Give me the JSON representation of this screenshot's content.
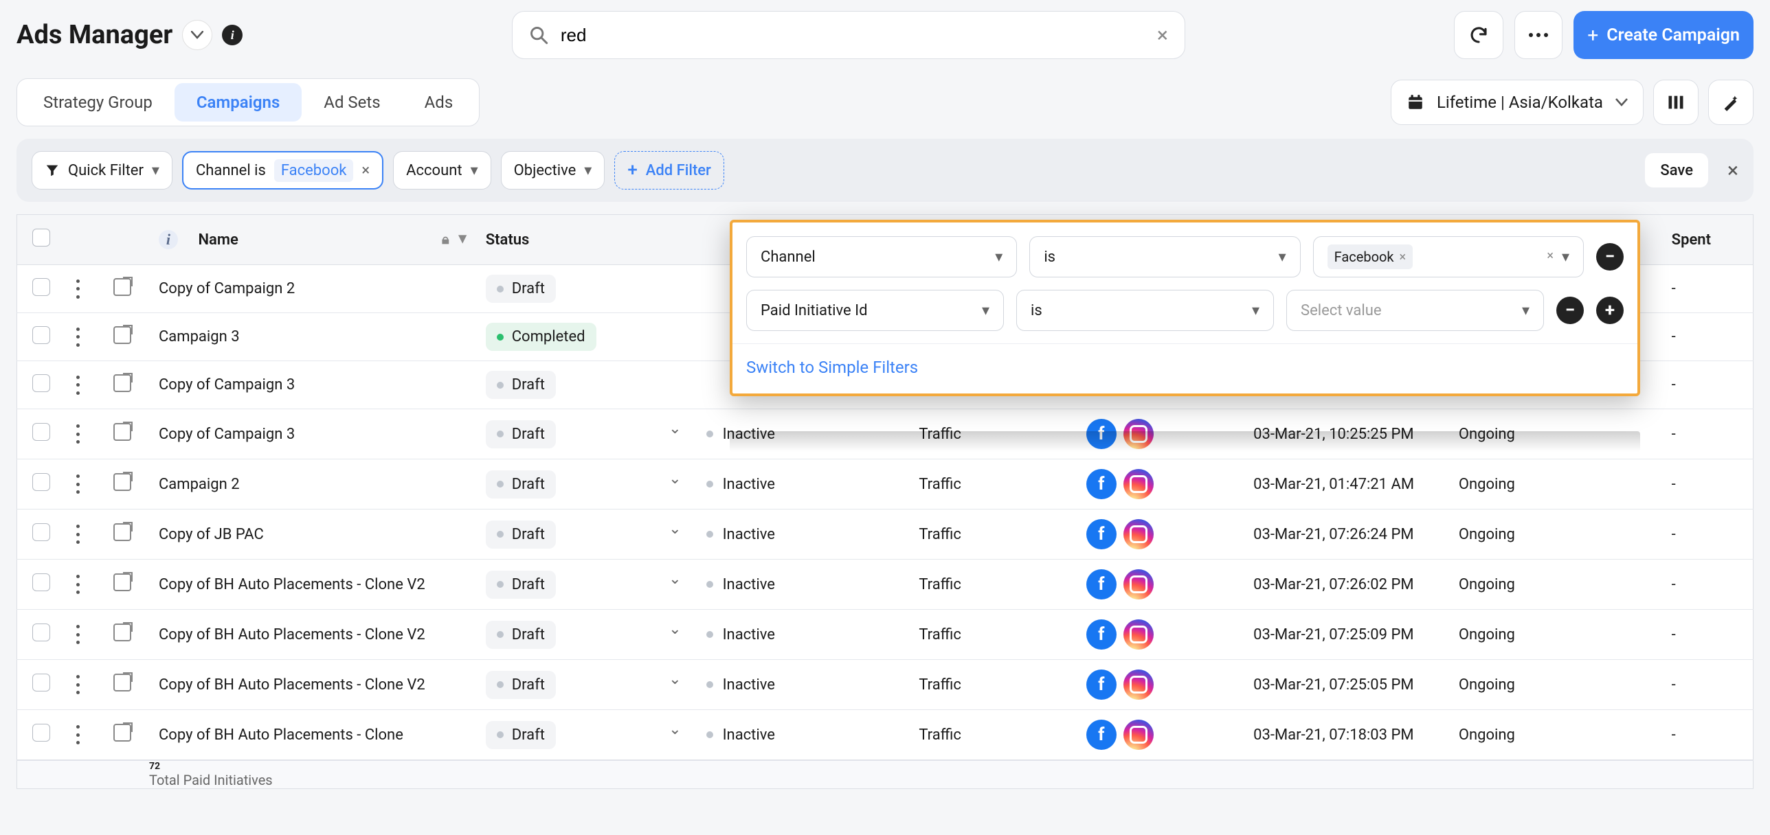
{
  "header": {
    "title": "Ads Manager",
    "search_value": "red",
    "create_label": "Create Campaign"
  },
  "tabs": {
    "strategy": "Strategy Group",
    "campaigns": "Campaigns",
    "adsets": "Ad Sets",
    "ads": "Ads"
  },
  "daterange": {
    "label": "Lifetime | Asia/Kolkata"
  },
  "filters": {
    "quick": "Quick Filter",
    "channel_label": "Channel is",
    "channel_value": "Facebook",
    "account": "Account",
    "objective": "Objective",
    "add": "Add Filter",
    "save": "Save"
  },
  "popover": {
    "row1": {
      "field": "Channel",
      "op": "is",
      "value": "Facebook"
    },
    "row2": {
      "field": "Paid Initiative Id",
      "op": "is",
      "placeholder": "Select value"
    },
    "switch": "Switch to Simple Filters"
  },
  "columns": {
    "name": "Name",
    "status": "Status",
    "po_status": "",
    "objective": "",
    "channels": "",
    "created": "",
    "duration": "",
    "spent": "Spent"
  },
  "status_values": {
    "draft": "Draft",
    "completed": "Completed",
    "inactive": "Inactive"
  },
  "objective_values": {
    "traffic": "Traffic"
  },
  "duration_values": {
    "ongoing": "Ongoing"
  },
  "spent_placeholder": "-",
  "rows": [
    {
      "name": "Copy of Campaign 2",
      "status": "draft"
    },
    {
      "name": "Campaign 3",
      "status": "completed"
    },
    {
      "name": "Copy of Campaign 3",
      "status": "draft"
    },
    {
      "name": "Copy of Campaign 3",
      "status": "draft",
      "po": "inactive",
      "obj": "traffic",
      "created": "03-Mar-21, 10:25:25 PM",
      "duration": "ongoing",
      "spent": "-"
    },
    {
      "name": "Campaign 2",
      "status": "draft",
      "po": "inactive",
      "obj": "traffic",
      "created": "03-Mar-21, 01:47:21 AM",
      "duration": "ongoing",
      "spent": "-"
    },
    {
      "name": "Copy of JB PAC",
      "status": "draft",
      "po": "inactive",
      "obj": "traffic",
      "created": "03-Mar-21, 07:26:24 PM",
      "duration": "ongoing",
      "spent": "-"
    },
    {
      "name": "Copy of BH Auto Placements - Clone V2",
      "status": "draft",
      "po": "inactive",
      "obj": "traffic",
      "created": "03-Mar-21, 07:26:02 PM",
      "duration": "ongoing",
      "spent": "-"
    },
    {
      "name": "Copy of BH Auto Placements - Clone V2",
      "status": "draft",
      "po": "inactive",
      "obj": "traffic",
      "created": "03-Mar-21, 07:25:09 PM",
      "duration": "ongoing",
      "spent": "-"
    },
    {
      "name": "Copy of BH Auto Placements - Clone V2",
      "status": "draft",
      "po": "inactive",
      "obj": "traffic",
      "created": "03-Mar-21, 07:25:05 PM",
      "duration": "ongoing",
      "spent": "-"
    },
    {
      "name": "Copy of BH Auto Placements - Clone",
      "status": "draft",
      "po": "inactive",
      "obj": "traffic",
      "created": "03-Mar-21, 07:18:03 PM",
      "duration": "ongoing",
      "spent": "-"
    }
  ],
  "footer": {
    "count": "72",
    "label": "Total Paid Initiatives"
  }
}
